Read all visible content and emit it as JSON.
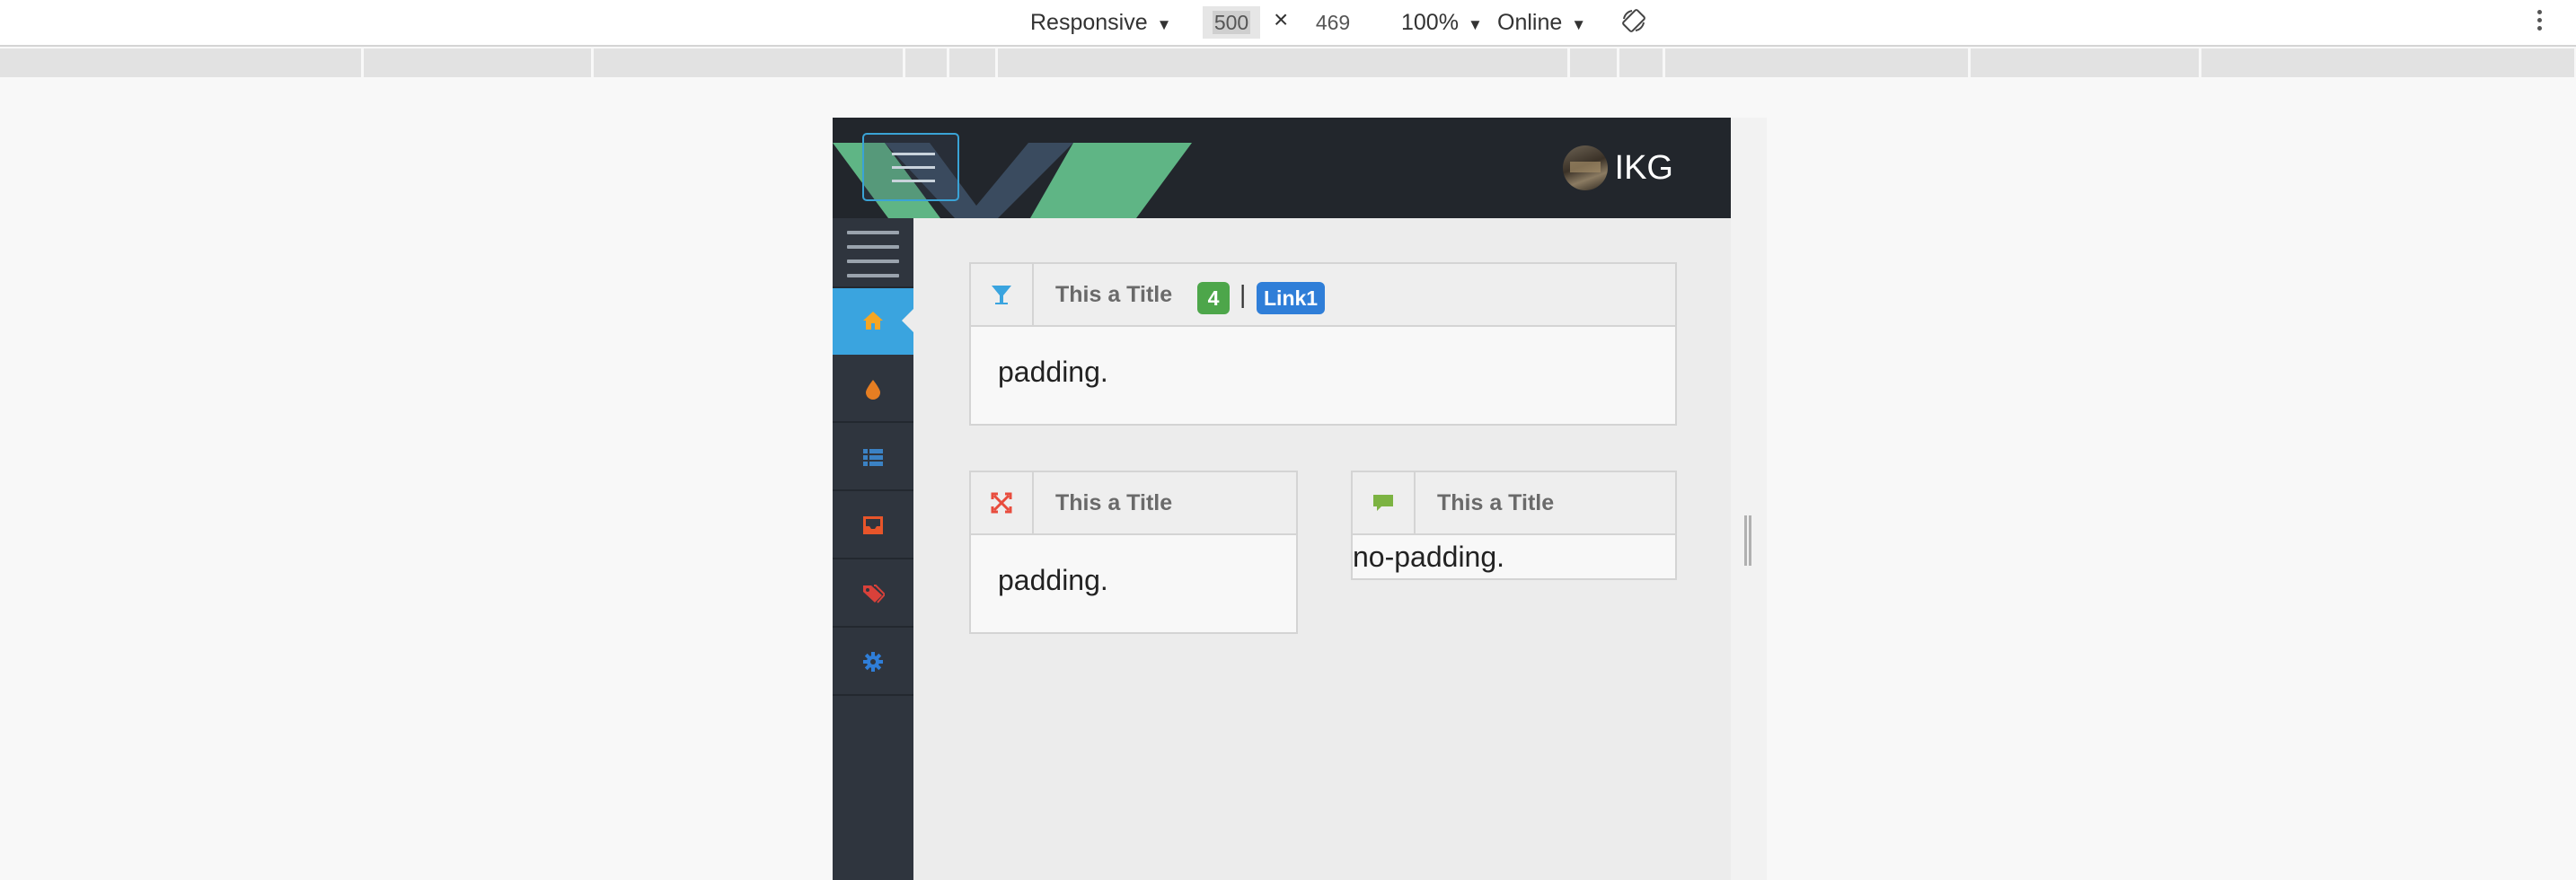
{
  "devtools": {
    "device": "Responsive",
    "width": "500",
    "height": "469",
    "zoom": "100%",
    "network": "Online"
  },
  "navbar": {
    "user_name": "IKG"
  },
  "sidebar": {
    "items": [
      {
        "icon": "home-icon",
        "color": "#f5a623",
        "active": true
      },
      {
        "icon": "drop-icon",
        "color": "#e67e22",
        "active": false
      },
      {
        "icon": "list-icon",
        "color": "#3b82c4",
        "active": false
      },
      {
        "icon": "inbox-icon",
        "color": "#e8552a",
        "active": false
      },
      {
        "icon": "tags-icon",
        "color": "#d9413a",
        "active": false
      },
      {
        "icon": "gear-icon",
        "color": "#2f7ed8",
        "active": false
      }
    ]
  },
  "panels": {
    "top": {
      "icon": "cocktail-icon",
      "title": "This a Title",
      "badge_count": "4",
      "separator": "|",
      "link_label": "Link1",
      "body": "padding."
    },
    "bottom_left": {
      "icon": "expand-icon",
      "title": "This a Title",
      "body": "padding."
    },
    "bottom_right": {
      "icon": "comment-icon",
      "title": "This a Title",
      "body": "no-padding."
    }
  },
  "colors": {
    "accent": "#3aa4df",
    "navbar_bg": "#22262c",
    "sidebar_bg": "#2f353e",
    "badge_green": "#4da64a",
    "badge_blue": "#2f7ed8"
  }
}
